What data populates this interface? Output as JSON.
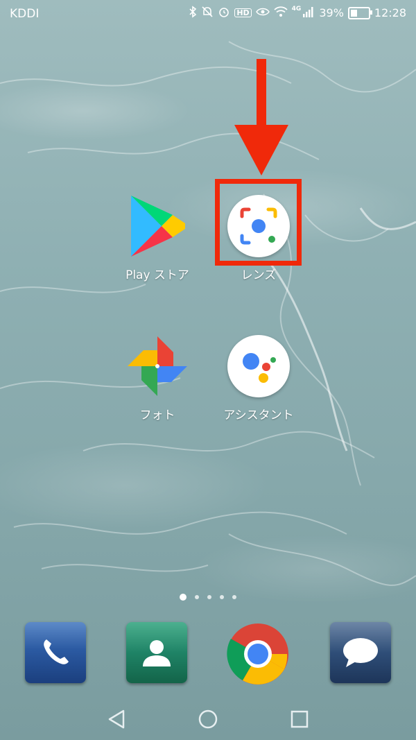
{
  "status_bar": {
    "carrier": "KDDI",
    "network": "4G",
    "battery_percent": "39%",
    "battery_level": 0.39,
    "time": "12:28",
    "icons": [
      "bluetooth-icon",
      "mute-icon",
      "alarm-icon",
      "hd-icon",
      "eye-comfort-icon",
      "wifi-icon",
      "signal-icon",
      "battery-icon"
    ]
  },
  "apps": [
    {
      "label": "Play ストア",
      "icon": "play-store-icon"
    },
    {
      "label": "レンズ",
      "icon": "lens-icon"
    },
    {
      "label": "フォト",
      "icon": "photos-icon"
    },
    {
      "label": "アシスタント",
      "icon": "assistant-icon"
    }
  ],
  "annotation": {
    "color": "#f0290a",
    "target": "レンズ"
  },
  "page_indicator": {
    "count": 5,
    "active": 0
  },
  "dock": [
    {
      "icon": "phone-icon"
    },
    {
      "icon": "contacts-icon"
    },
    {
      "icon": "chrome-icon"
    },
    {
      "icon": "messages-icon"
    }
  ],
  "nav": {
    "buttons": [
      "back-icon",
      "home-icon",
      "recents-icon"
    ]
  }
}
